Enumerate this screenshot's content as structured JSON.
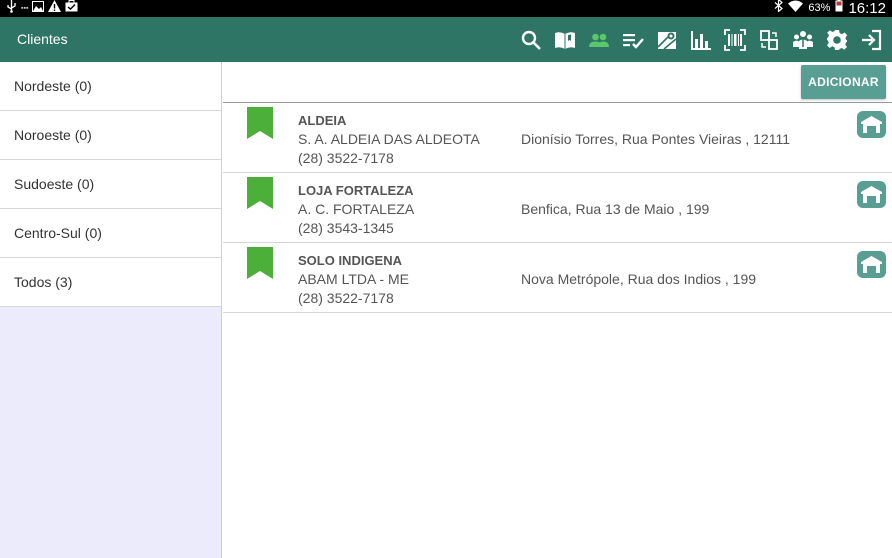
{
  "status_bar": {
    "left_icons": [
      "usb-icon",
      "image-icon",
      "warning-icon",
      "briefcase-icon"
    ],
    "battery": "63%",
    "time": "16:12"
  },
  "app_bar": {
    "title": "Clientes",
    "icons": [
      {
        "name": "search-icon",
        "active": false
      },
      {
        "name": "catalog-book-icon",
        "active": false
      },
      {
        "name": "clients-people-icon",
        "active": true
      },
      {
        "name": "checklist-icon",
        "active": false
      },
      {
        "name": "map-icon",
        "active": false
      },
      {
        "name": "bar-chart-icon",
        "active": false
      },
      {
        "name": "barcode-icon",
        "active": false
      },
      {
        "name": "sync-icon",
        "active": false
      },
      {
        "name": "team-icon",
        "active": false
      },
      {
        "name": "settings-icon",
        "active": false
      },
      {
        "name": "exit-icon",
        "active": false
      }
    ],
    "colors": {
      "background": "#2e7565",
      "icon": "#ffffff",
      "active_icon": "#5cc66a"
    }
  },
  "sidebar": {
    "items": [
      {
        "label": "Nordeste (0)"
      },
      {
        "label": "Noroeste (0)"
      },
      {
        "label": "Sudoeste (0)"
      },
      {
        "label": "Centro-Sul (0)"
      },
      {
        "label": "Todos (3)"
      }
    ]
  },
  "toolbar": {
    "add_label": "ADICIONAR"
  },
  "clients": [
    {
      "name": "ALDEIA",
      "company": "S. A. ALDEIA DAS ALDEOTA",
      "phone": "(28) 3522-7178",
      "address": "Dionísio Torres, Rua Pontes Vieiras , 12111"
    },
    {
      "name": "LOJA FORTALEZA",
      "company": "A. C. FORTALEZA",
      "phone": "(28) 3543-1345",
      "address": "Benfica, Rua 13 de Maio , 199"
    },
    {
      "name": "SOLO INDIGENA",
      "company": "ABAM LTDA - ME",
      "phone": "(28) 3522-7178",
      "address": "Nova Metrópole, Rua dos Indios , 199"
    }
  ],
  "colors": {
    "bookmark": "#4caf3a",
    "store_button": "#589e92",
    "add_button": "#589e92"
  }
}
